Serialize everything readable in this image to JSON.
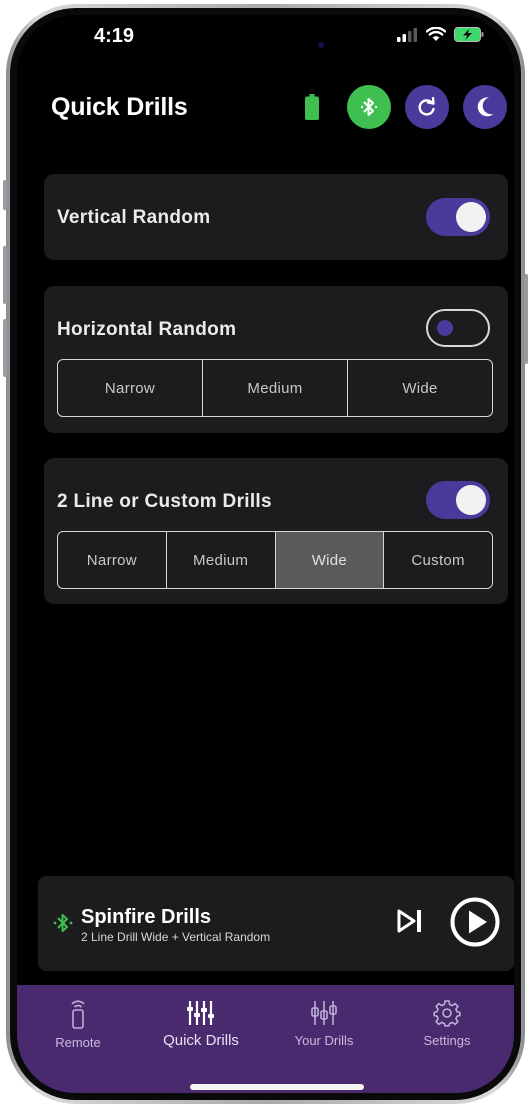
{
  "status_bar": {
    "time": "4:19"
  },
  "header": {
    "title": "Quick Drills"
  },
  "colors": {
    "accent": "#4b3a9c",
    "bluetooth_green": "#3fbf4f",
    "tabbar": "#4a2a6e",
    "card": "#1c1c1e",
    "selected_segment": "#5a5a5c"
  },
  "header_icons": [
    "battery-icon",
    "bluetooth-icon",
    "refresh-icon",
    "moon-icon"
  ],
  "cards": {
    "vertical": {
      "title": "Vertical Random",
      "enabled": true
    },
    "horizontal": {
      "title": "Horizontal Random",
      "enabled": false,
      "options": [
        "Narrow",
        "Medium",
        "Wide"
      ],
      "selected": null
    },
    "two_line": {
      "title": "2 Line or Custom Drills",
      "enabled": true,
      "options": [
        "Narrow",
        "Medium",
        "Wide",
        "Custom"
      ],
      "selected": "Wide"
    }
  },
  "player": {
    "name": "Spinfire Drills",
    "subtitle": "2 Line Drill Wide + Vertical Random"
  },
  "tabs": [
    {
      "label": "Remote",
      "icon": "remote-icon",
      "active": false
    },
    {
      "label": "Quick Drills",
      "icon": "quick-drills-icon",
      "active": true
    },
    {
      "label": "Your Drills",
      "icon": "your-drills-icon",
      "active": false
    },
    {
      "label": "Settings",
      "icon": "gear-icon",
      "active": false
    }
  ]
}
